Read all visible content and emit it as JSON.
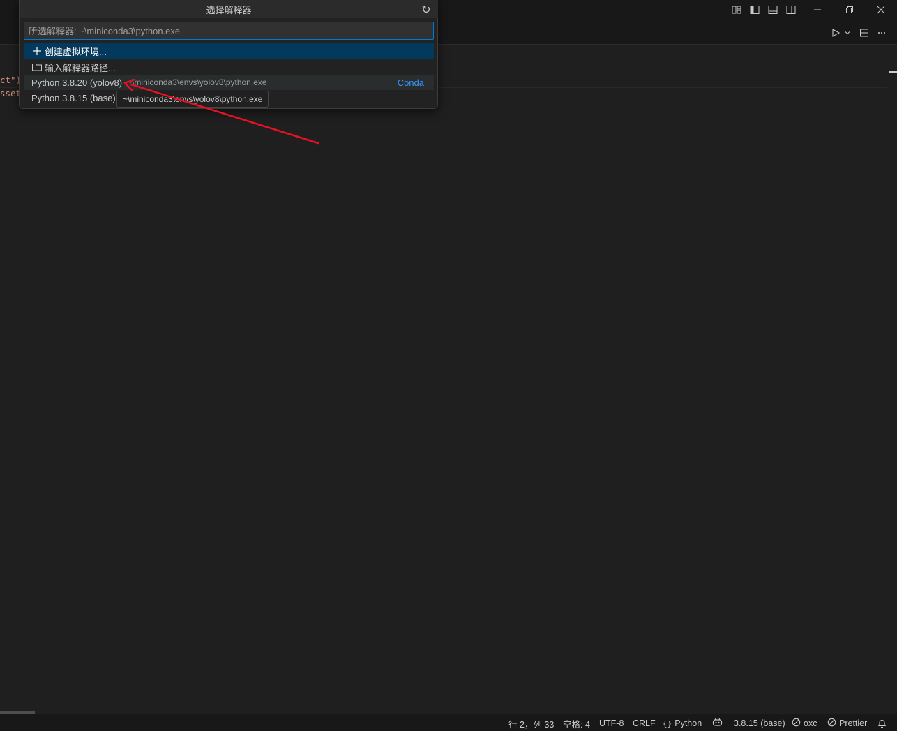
{
  "quick_pick": {
    "title": "选择解释器",
    "input_value": "",
    "placeholder": "所选解释器: ~\\miniconda3\\python.exe",
    "items": [
      {
        "icon": "plus-icon",
        "label": "创建虚拟环境..."
      },
      {
        "icon": "folder-icon",
        "label": "输入解释器路径..."
      },
      {
        "label": "Python 3.8.20 (yolov8)",
        "description": "~\\miniconda3\\envs\\yolov8\\python.exe",
        "detail": "Conda"
      },
      {
        "label": "Python 3.8.15 (base)"
      }
    ],
    "tooltip": "~\\miniconda3\\envs\\yolov8\\python.exe"
  },
  "editor": {
    "lines": [
      {
        "text": "ct\")",
        "partial": true
      },
      {
        "text": "sset",
        "partial": true
      }
    ]
  },
  "title_bar": {
    "icons": [
      "customize-layout-icon",
      "toggle-primary-sidebar-icon",
      "toggle-panel-icon",
      "toggle-secondary-sidebar-icon"
    ],
    "window_controls": [
      "minimize-icon",
      "restore-icon",
      "close-icon"
    ]
  },
  "editor_actions": [
    "run-icon",
    "chevron-down-icon",
    "split-editor-icon",
    "more-actions-icon"
  ],
  "status_bar": {
    "position": "行 2，列 33",
    "spaces": "空格: 4",
    "encoding": "UTF-8",
    "eol": "CRLF",
    "language": "Python",
    "interpreter": "3.8.15 (base)",
    "oxc": "oxc",
    "prettier": "Prettier"
  },
  "colors": {
    "accent": "#0078d4",
    "selection": "#04395e",
    "link": "#3794ff",
    "annotation_arrow": "#e81123",
    "string": "#ce9178"
  }
}
